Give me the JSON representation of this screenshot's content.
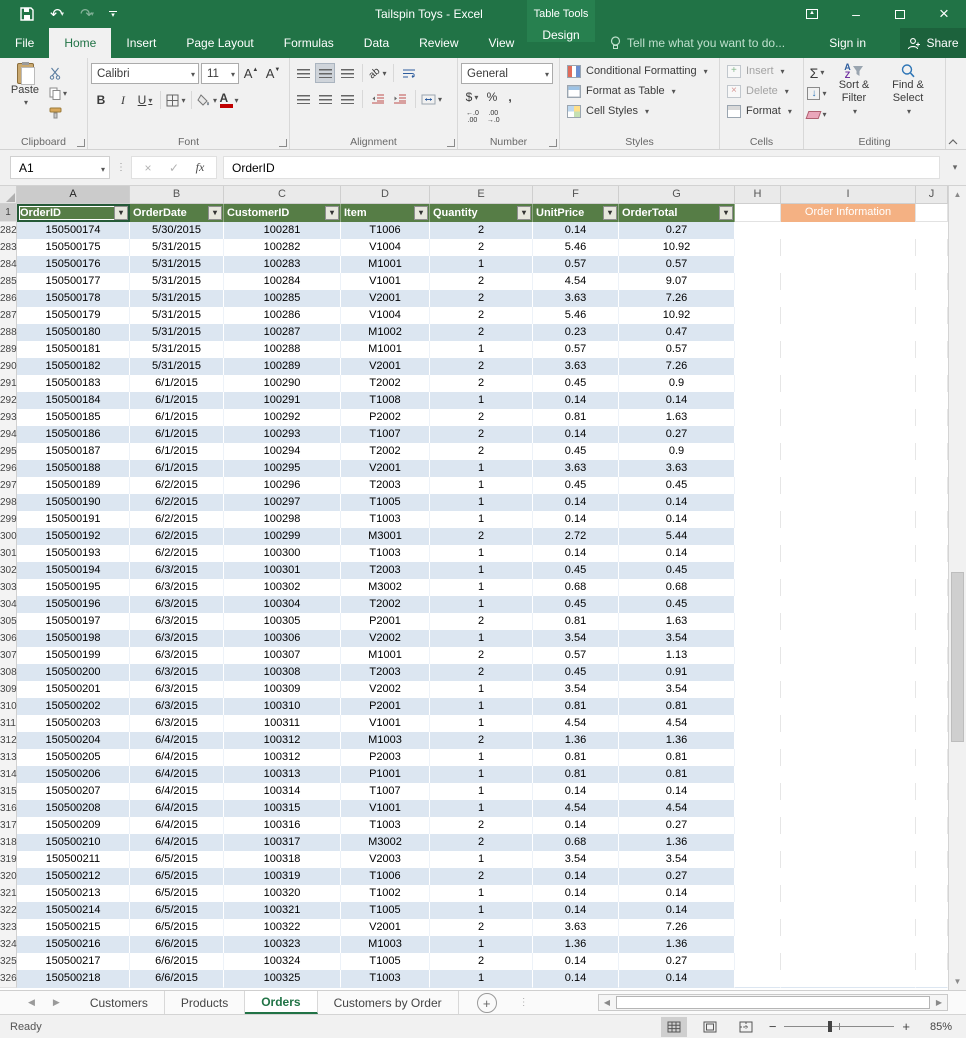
{
  "titlebar": {
    "title": "Tailspin Toys - Excel",
    "contextual": "Table Tools"
  },
  "ribbon_tabs": {
    "file": "File",
    "home": "Home",
    "insert": "Insert",
    "page_layout": "Page Layout",
    "formulas": "Formulas",
    "data": "Data",
    "review": "Review",
    "view": "View",
    "design": "Design",
    "tell_me": "Tell me what you want to do...",
    "sign_in": "Sign in",
    "share": "Share"
  },
  "ribbon": {
    "clipboard": {
      "label": "Clipboard",
      "paste": "Paste"
    },
    "font": {
      "label": "Font",
      "family": "Calibri",
      "size": "11",
      "bold": "B",
      "italic": "I",
      "underline": "U",
      "grow": "A",
      "shrink": "A"
    },
    "alignment": {
      "label": "Alignment",
      "orientation": "ab"
    },
    "number": {
      "label": "Number",
      "format": "General",
      "dollar": "$",
      "percent": "%",
      "comma": ",",
      "inc_dec_top": "←.0",
      "inc_dec_bottom": ".00",
      "dec_dec_top": ".00",
      "dec_dec_bottom": "→.0"
    },
    "styles": {
      "label": "Styles",
      "conditional": "Conditional Formatting",
      "format_table": "Format as Table",
      "cell_styles": "Cell Styles"
    },
    "cells": {
      "label": "Cells",
      "insert": "Insert",
      "delete": "Delete",
      "format": "Format"
    },
    "editing": {
      "label": "Editing",
      "autosum": "Σ",
      "sort_line1": "Sort &",
      "sort_line2": "Filter",
      "find_line1": "Find &",
      "find_line2": "Select",
      "az_a": "A",
      "az_z": "Z"
    }
  },
  "formula_bar": {
    "name_box": "A1",
    "cancel": "×",
    "enter": "✓",
    "fx": "fx",
    "content": "OrderID"
  },
  "grid": {
    "column_letters": [
      "A",
      "B",
      "C",
      "D",
      "E",
      "F",
      "G",
      "H",
      "I",
      "J"
    ],
    "header_row_number": "1",
    "headers": [
      "OrderID",
      "OrderDate",
      "CustomerID",
      "Item",
      "Quantity",
      "UnitPrice",
      "OrderTotal"
    ],
    "order_info_label": "Order Information",
    "rows": [
      [
        282,
        "150500174",
        "5/30/2015",
        "100281",
        "T1006",
        "2",
        "0.14",
        "0.27"
      ],
      [
        283,
        "150500175",
        "5/31/2015",
        "100282",
        "V1004",
        "2",
        "5.46",
        "10.92"
      ],
      [
        284,
        "150500176",
        "5/31/2015",
        "100283",
        "M1001",
        "1",
        "0.57",
        "0.57"
      ],
      [
        285,
        "150500177",
        "5/31/2015",
        "100284",
        "V1001",
        "2",
        "4.54",
        "9.07"
      ],
      [
        286,
        "150500178",
        "5/31/2015",
        "100285",
        "V2001",
        "2",
        "3.63",
        "7.26"
      ],
      [
        287,
        "150500179",
        "5/31/2015",
        "100286",
        "V1004",
        "2",
        "5.46",
        "10.92"
      ],
      [
        288,
        "150500180",
        "5/31/2015",
        "100287",
        "M1002",
        "2",
        "0.23",
        "0.47"
      ],
      [
        289,
        "150500181",
        "5/31/2015",
        "100288",
        "M1001",
        "1",
        "0.57",
        "0.57"
      ],
      [
        290,
        "150500182",
        "5/31/2015",
        "100289",
        "V2001",
        "2",
        "3.63",
        "7.26"
      ],
      [
        291,
        "150500183",
        "6/1/2015",
        "100290",
        "T2002",
        "2",
        "0.45",
        "0.9"
      ],
      [
        292,
        "150500184",
        "6/1/2015",
        "100291",
        "T1008",
        "1",
        "0.14",
        "0.14"
      ],
      [
        293,
        "150500185",
        "6/1/2015",
        "100292",
        "P2002",
        "2",
        "0.81",
        "1.63"
      ],
      [
        294,
        "150500186",
        "6/1/2015",
        "100293",
        "T1007",
        "2",
        "0.14",
        "0.27"
      ],
      [
        295,
        "150500187",
        "6/1/2015",
        "100294",
        "T2002",
        "2",
        "0.45",
        "0.9"
      ],
      [
        296,
        "150500188",
        "6/1/2015",
        "100295",
        "V2001",
        "1",
        "3.63",
        "3.63"
      ],
      [
        297,
        "150500189",
        "6/2/2015",
        "100296",
        "T2003",
        "1",
        "0.45",
        "0.45"
      ],
      [
        298,
        "150500190",
        "6/2/2015",
        "100297",
        "T1005",
        "1",
        "0.14",
        "0.14"
      ],
      [
        299,
        "150500191",
        "6/2/2015",
        "100298",
        "T1003",
        "1",
        "0.14",
        "0.14"
      ],
      [
        300,
        "150500192",
        "6/2/2015",
        "100299",
        "M3001",
        "2",
        "2.72",
        "5.44"
      ],
      [
        301,
        "150500193",
        "6/2/2015",
        "100300",
        "T1003",
        "1",
        "0.14",
        "0.14"
      ],
      [
        302,
        "150500194",
        "6/3/2015",
        "100301",
        "T2003",
        "1",
        "0.45",
        "0.45"
      ],
      [
        303,
        "150500195",
        "6/3/2015",
        "100302",
        "M3002",
        "1",
        "0.68",
        "0.68"
      ],
      [
        304,
        "150500196",
        "6/3/2015",
        "100304",
        "T2002",
        "1",
        "0.45",
        "0.45"
      ],
      [
        305,
        "150500197",
        "6/3/2015",
        "100305",
        "P2001",
        "2",
        "0.81",
        "1.63"
      ],
      [
        306,
        "150500198",
        "6/3/2015",
        "100306",
        "V2002",
        "1",
        "3.54",
        "3.54"
      ],
      [
        307,
        "150500199",
        "6/3/2015",
        "100307",
        "M1001",
        "2",
        "0.57",
        "1.13"
      ],
      [
        308,
        "150500200",
        "6/3/2015",
        "100308",
        "T2003",
        "2",
        "0.45",
        "0.91"
      ],
      [
        309,
        "150500201",
        "6/3/2015",
        "100309",
        "V2002",
        "1",
        "3.54",
        "3.54"
      ],
      [
        310,
        "150500202",
        "6/3/2015",
        "100310",
        "P2001",
        "1",
        "0.81",
        "0.81"
      ],
      [
        311,
        "150500203",
        "6/3/2015",
        "100311",
        "V1001",
        "1",
        "4.54",
        "4.54"
      ],
      [
        312,
        "150500204",
        "6/4/2015",
        "100312",
        "M1003",
        "2",
        "1.36",
        "1.36"
      ],
      [
        313,
        "150500205",
        "6/4/2015",
        "100312",
        "P2003",
        "1",
        "0.81",
        "0.81"
      ],
      [
        314,
        "150500206",
        "6/4/2015",
        "100313",
        "P1001",
        "1",
        "0.81",
        "0.81"
      ],
      [
        315,
        "150500207",
        "6/4/2015",
        "100314",
        "T1007",
        "1",
        "0.14",
        "0.14"
      ],
      [
        316,
        "150500208",
        "6/4/2015",
        "100315",
        "V1001",
        "1",
        "4.54",
        "4.54"
      ],
      [
        317,
        "150500209",
        "6/4/2015",
        "100316",
        "T1003",
        "2",
        "0.14",
        "0.27"
      ],
      [
        318,
        "150500210",
        "6/4/2015",
        "100317",
        "M3002",
        "2",
        "0.68",
        "1.36"
      ],
      [
        319,
        "150500211",
        "6/5/2015",
        "100318",
        "V2003",
        "1",
        "3.54",
        "3.54"
      ],
      [
        320,
        "150500212",
        "6/5/2015",
        "100319",
        "T1006",
        "2",
        "0.14",
        "0.27"
      ],
      [
        321,
        "150500213",
        "6/5/2015",
        "100320",
        "T1002",
        "1",
        "0.14",
        "0.14"
      ],
      [
        322,
        "150500214",
        "6/5/2015",
        "100321",
        "T1005",
        "1",
        "0.14",
        "0.14"
      ],
      [
        323,
        "150500215",
        "6/5/2015",
        "100322",
        "V2001",
        "2",
        "3.63",
        "7.26"
      ],
      [
        324,
        "150500216",
        "6/6/2015",
        "100323",
        "M1003",
        "1",
        "1.36",
        "1.36"
      ],
      [
        325,
        "150500217",
        "6/6/2015",
        "100324",
        "T1005",
        "2",
        "0.14",
        "0.27"
      ],
      [
        326,
        "150500218",
        "6/6/2015",
        "100325",
        "T1003",
        "1",
        "0.14",
        "0.14"
      ]
    ]
  },
  "sheet_bar": {
    "tabs": [
      "Customers",
      "Products",
      "Orders",
      "Customers by Order"
    ],
    "active_tab": "Orders",
    "add_label": "+"
  },
  "status_bar": {
    "ready": "Ready",
    "zoom": "85%",
    "zoom_out": "−",
    "zoom_in": "+"
  },
  "icons": {
    "undo": "↶",
    "redo": "↷",
    "minimize": "–",
    "close": "×",
    "dots_vertical": "⋮",
    "up_arrow": "▲",
    "down_arrow": "▼",
    "left_arrow": "◀",
    "right_arrow": "▶",
    "filter_caret": "▾",
    "fill_down": "↓"
  },
  "colors": {
    "excel_green": "#217346",
    "table_header_green": "#567d46",
    "band_blue": "#dce6f1",
    "order_info_orange": "#f4b183",
    "accent_red": "#c00000"
  }
}
